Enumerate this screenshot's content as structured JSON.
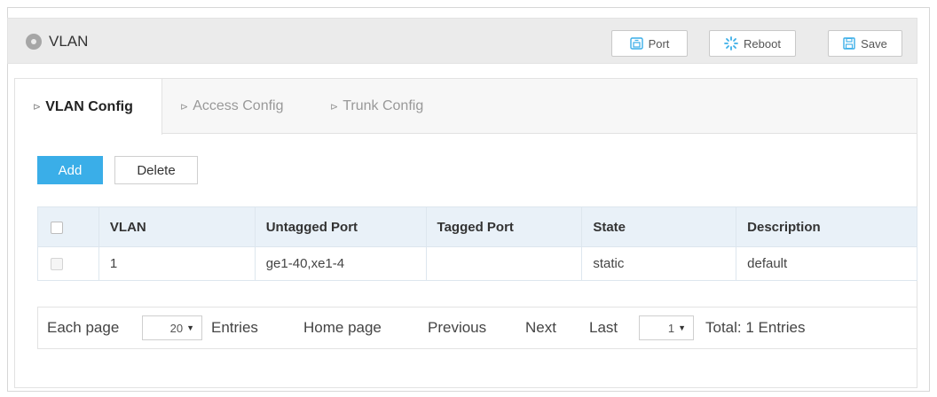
{
  "header": {
    "title": "VLAN",
    "buttons": {
      "port": "Port",
      "reboot": "Reboot",
      "save": "Save"
    }
  },
  "tabs": [
    {
      "label": "VLAN Config",
      "active": true
    },
    {
      "label": "Access Config",
      "active": false
    },
    {
      "label": "Trunk Config",
      "active": false
    }
  ],
  "actions": {
    "add": "Add",
    "delete": "Delete"
  },
  "table": {
    "columns": [
      "VLAN",
      "Untagged Port",
      "Tagged Port",
      "State",
      "Description"
    ],
    "rows": [
      {
        "vlan": "1",
        "untagged": "ge1-40,xe1-4",
        "tagged": "",
        "state": "static",
        "description": "default"
      }
    ]
  },
  "pagination": {
    "each_page_label": "Each page",
    "page_size": "20",
    "entries_label": "Entries",
    "home": "Home page",
    "previous": "Previous",
    "next": "Next",
    "last": "Last",
    "current_page": "1",
    "total": "Total: 1 Entries"
  },
  "colors": {
    "accent": "#3aaee8",
    "header_bg": "#ebebeb",
    "table_header_bg": "#e9f1f8"
  }
}
